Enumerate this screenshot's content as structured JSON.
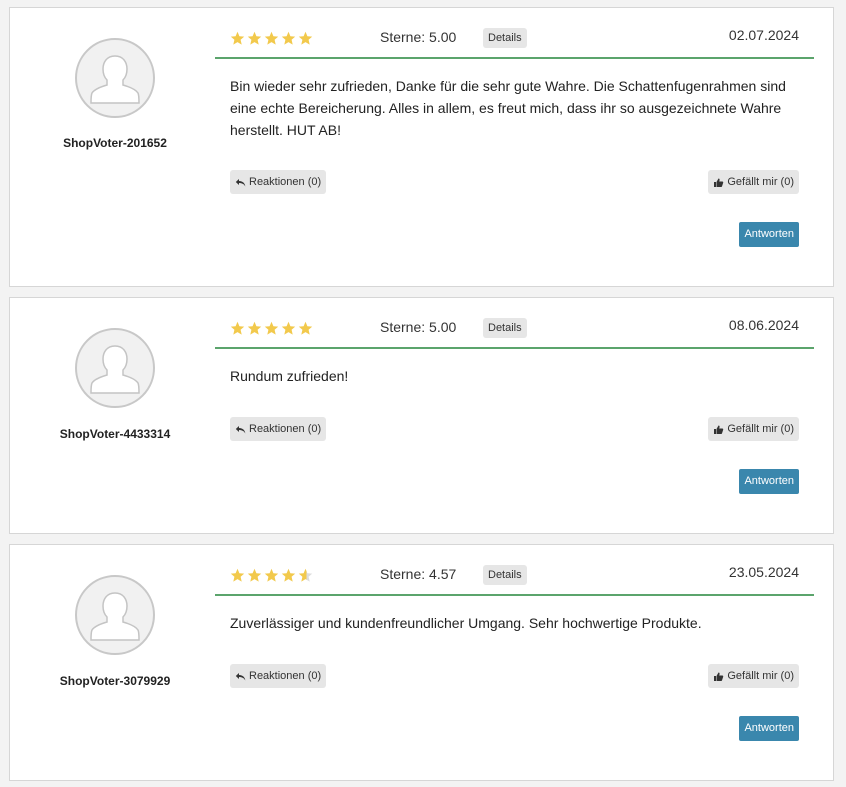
{
  "colors": {
    "accent_line": "#5ba46c",
    "star_fill": "#f2c94c",
    "star_empty": "#dddddd",
    "reply_button": "#3a87ad"
  },
  "reviews": [
    {
      "username": "ShopVoter-201652",
      "stars": 5,
      "sterne_label": "Sterne: 5.00",
      "details_label": "Details",
      "date": "02.07.2024",
      "text": "Bin wieder sehr zufrieden, Danke für die sehr gute Wahre. Die Schattenfugenrahmen sind eine echte Bereicherung. Alles in allem, es freut mich, dass ihr so ausgezeichnete Wahre herstellt. HUT AB!",
      "reactions_label": "Reaktionen (0)",
      "like_label": "Gefällt mir (0)",
      "reply_label": "Antworten"
    },
    {
      "username": "ShopVoter-4433314",
      "stars": 5,
      "sterne_label": "Sterne: 5.00",
      "details_label": "Details",
      "date": "08.06.2024",
      "text": "Rundum zufrieden!",
      "reactions_label": "Reaktionen (0)",
      "like_label": "Gefällt mir (0)",
      "reply_label": "Antworten"
    },
    {
      "username": "ShopVoter-3079929",
      "stars": 4.57,
      "sterne_label": "Sterne: 4.57",
      "details_label": "Details",
      "date": "23.05.2024",
      "text": "Zuverlässiger und kundenfreundlicher Umgang. Sehr hochwertige Produkte.",
      "reactions_label": "Reaktionen (0)",
      "like_label": "Gefällt mir (0)",
      "reply_label": "Antworten"
    }
  ]
}
